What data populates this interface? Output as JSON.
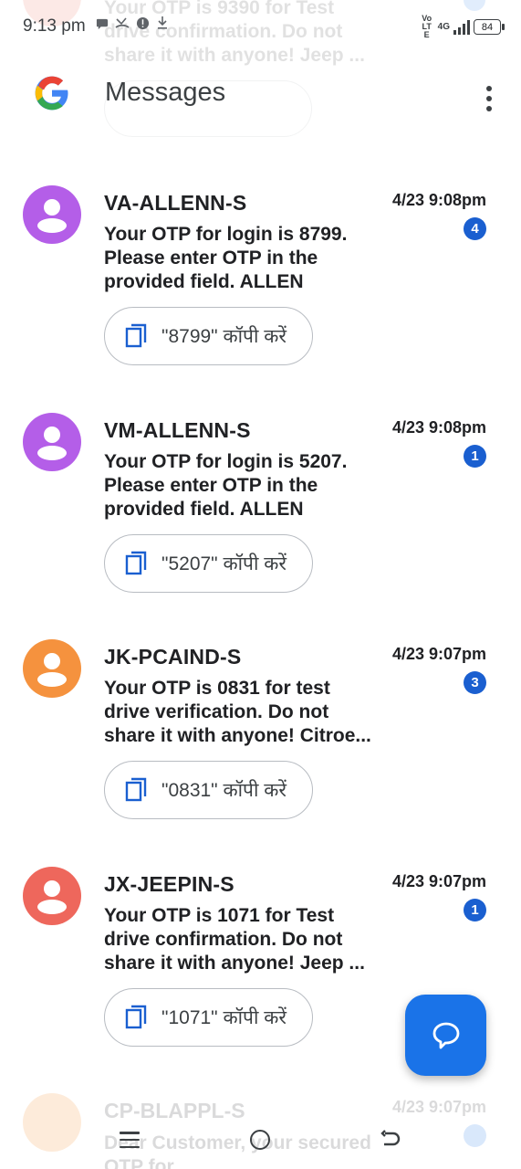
{
  "status_bar": {
    "time": "9:13 pm",
    "network_label": "Vo LTE",
    "network_type": "4G",
    "battery": "84"
  },
  "header": {
    "app_title": "Messages",
    "logo": "google-g-logo",
    "menu_icon": "more-vert-icon"
  },
  "ghost_top": {
    "preview": "Your OTP is 9390 for Test drive confirmation. Do not share it with anyone! Jeep ..."
  },
  "conversations": [
    {
      "sender": "VA-ALLENN-S",
      "time": "4/23 9:08pm",
      "unread": "4",
      "preview": "Your OTP for login is 8799. Please enter OTP in the provided field. ALLEN",
      "chip_label": "\"8799\" कॉपी करें",
      "avatar_color": "#b45ee8"
    },
    {
      "sender": "VM-ALLENN-S",
      "time": "4/23 9:08pm",
      "unread": "1",
      "preview": "Your OTP for login is 5207. Please enter OTP in the provided field. ALLEN",
      "chip_label": "\"5207\" कॉपी करें",
      "avatar_color": "#b45ee8"
    },
    {
      "sender": "JK-PCAIND-S",
      "time": "4/23 9:07pm",
      "unread": "3",
      "preview": "Your OTP is 0831 for test drive verification. Do not share it with anyone! Citroe...",
      "chip_label": "\"0831\" कॉपी करें",
      "avatar_color": "#f5923e"
    },
    {
      "sender": "JX-JEEPIN-S",
      "time": "4/23 9:07pm",
      "unread": "1",
      "preview": "Your OTP is 1071 for Test drive confirmation. Do not share it with anyone! Jeep ...",
      "chip_label": "\"1071\" कॉपी करें",
      "avatar_color": "#ee675c"
    }
  ],
  "ghost_bottom": {
    "sender": "CP-BLAPPL-S",
    "time": "4/23 9:07pm",
    "preview": "Dear Customer, your secured OTP for"
  },
  "fab": {
    "icon": "start-chat-icon"
  },
  "nav": {
    "menu_icon": "menu-icon",
    "home_icon": "home-icon",
    "back_icon": "back-icon"
  }
}
